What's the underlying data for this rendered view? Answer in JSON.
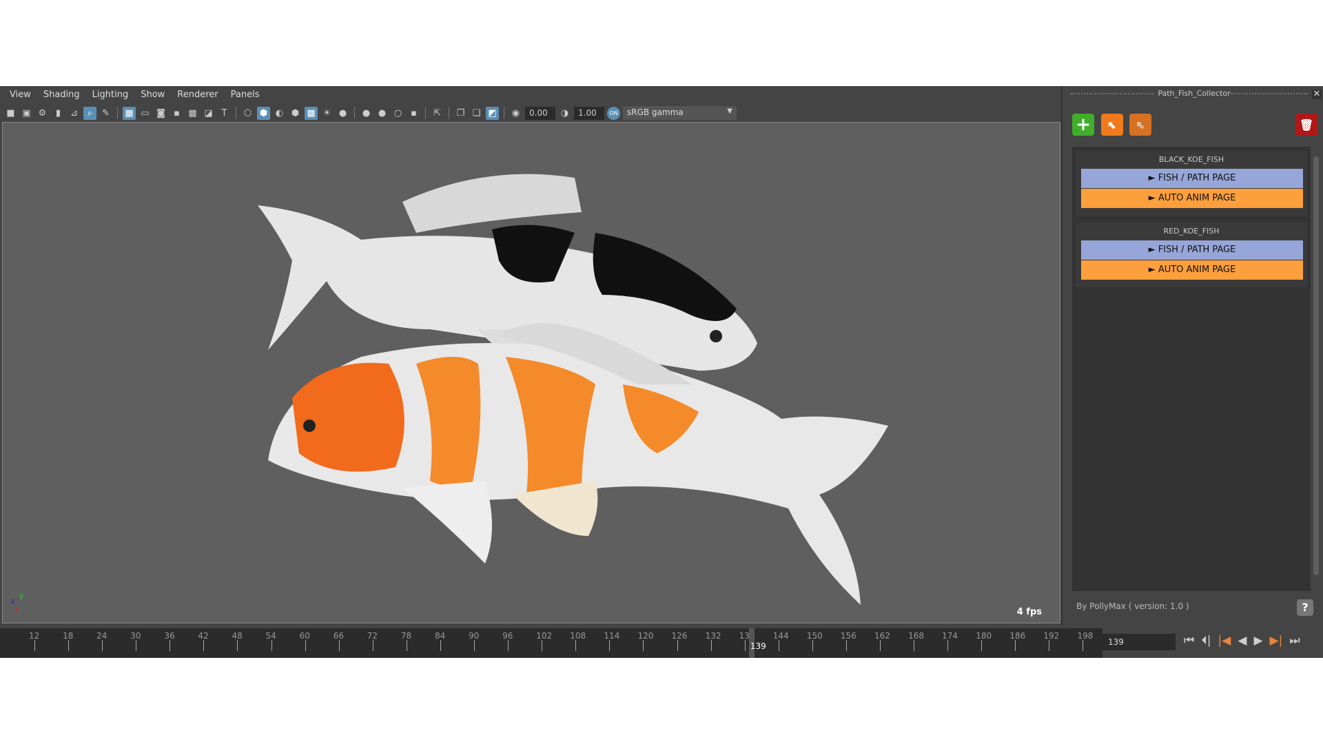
{
  "menu": [
    "View",
    "Shading",
    "Lighting",
    "Show",
    "Renderer",
    "Panels"
  ],
  "toolbar": {
    "exposure": "0.00",
    "gamma": "1.00",
    "color_space": "sRGB gamma"
  },
  "viewport": {
    "fps": "4 fps",
    "axes": {
      "x": "x",
      "y": "y",
      "z": "z"
    }
  },
  "timeline": {
    "ticks": [
      "12",
      "18",
      "24",
      "30",
      "36",
      "42",
      "48",
      "54",
      "60",
      "66",
      "72",
      "78",
      "84",
      "90",
      "96",
      "102",
      "108",
      "114",
      "120",
      "126",
      "132",
      "138",
      "144",
      "150",
      "156",
      "162",
      "168",
      "174",
      "180",
      "186",
      "192",
      "198"
    ],
    "current": "139",
    "frame_field": "139"
  },
  "panel": {
    "title": "Path_Fish_Collector",
    "groups": [
      {
        "name": "BLACK_KOE_FISH",
        "buttons": [
          "► FISH / PATH PAGE",
          "► AUTO ANIM PAGE"
        ]
      },
      {
        "name": "RED_KOE_FISH",
        "buttons": [
          "► FISH / PATH PAGE",
          "► AUTO ANIM PAGE"
        ]
      }
    ],
    "credit": "By PollyMax ( version: 1.0 )",
    "help": "?"
  },
  "colors": {
    "blue_button": "#97a6d8",
    "orange_button": "#fd9f3c",
    "add": "#3fae2a",
    "delete": "#b01818"
  }
}
